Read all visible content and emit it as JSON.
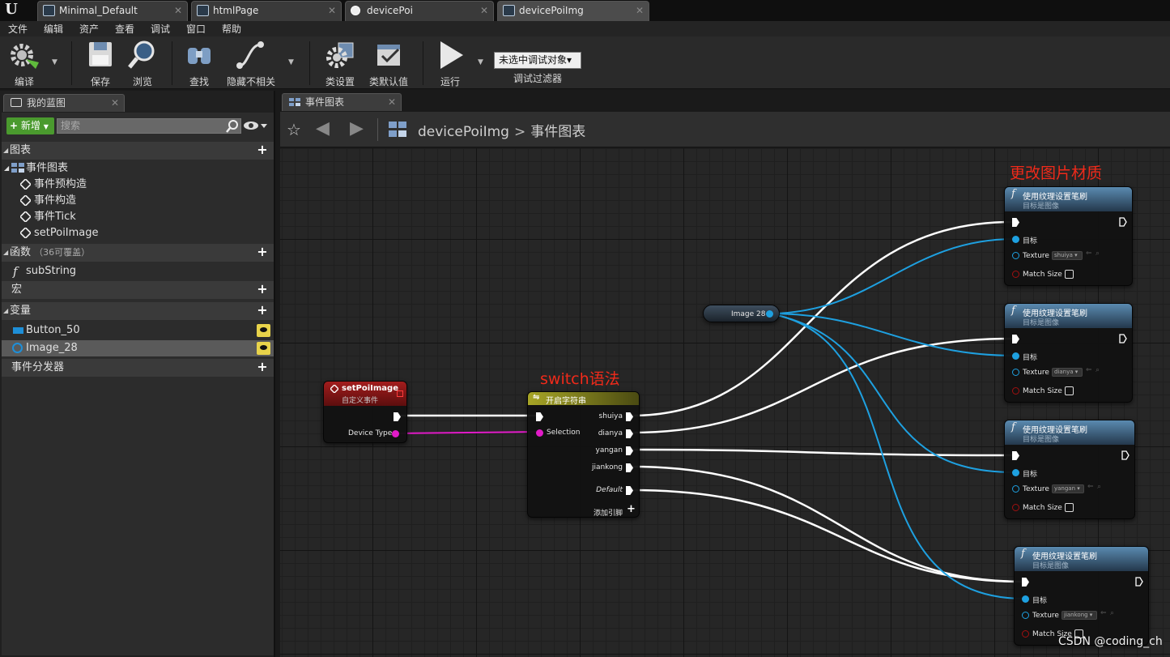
{
  "tabs": [
    {
      "label": "Minimal_Default"
    },
    {
      "label": "htmlPage"
    },
    {
      "label": "devicePoi"
    },
    {
      "label": "devicePoiImg"
    }
  ],
  "menu": [
    "文件",
    "编辑",
    "资产",
    "查看",
    "调试",
    "窗口",
    "帮助"
  ],
  "toolbar": {
    "compile": "编译",
    "save": "保存",
    "browse": "浏览",
    "find": "查找",
    "hide_unrelated": "隐藏不相关",
    "class_settings": "类设置",
    "class_defaults": "类默认值",
    "run": "运行",
    "debug_select": "未选中调试对象▾",
    "debug_filter": "调试过滤器"
  },
  "left_panel": {
    "tab": "我的蓝图",
    "add_new": "新增",
    "search_placeholder": "搜索",
    "sections": {
      "graphs": "图表",
      "event_graph": "事件图表",
      "events": [
        "事件预构造",
        "事件构造",
        "事件Tick",
        "setPoiImage"
      ],
      "functions": "函数",
      "functions_sub": "（36可覆盖）",
      "function_items": [
        "subString"
      ],
      "macros": "宏",
      "variables": "变量",
      "variable_items": [
        "Button_50",
        "Image_28"
      ],
      "dispatchers": "事件分发器"
    }
  },
  "graph": {
    "tab": "事件图表",
    "breadcrumb_root": "devicePoiImg",
    "breadcrumb_sep": ">",
    "breadcrumb_leaf": "事件图表",
    "annotations": {
      "switch": "switch语法",
      "change_material": "更改图片材质"
    },
    "event_node": {
      "title": "setPoiImage",
      "sub": "自定义事件",
      "pin": "Device Type"
    },
    "switch_node": {
      "title": "开启字符串",
      "input": "Selection",
      "outputs": [
        "shuiya",
        "dianya",
        "yangan",
        "jiankong"
      ],
      "default": "Default",
      "add_pin": "添加引脚"
    },
    "image_var": "Image 28",
    "brush_nodes": [
      {
        "title": "使用纹理设置笔刷",
        "sub": "目标是图像",
        "target": "目标",
        "texture_label": "Texture",
        "texture": "shuiya",
        "match_size": "Match Size"
      },
      {
        "title": "使用纹理设置笔刷",
        "sub": "目标是图像",
        "target": "目标",
        "texture_label": "Texture",
        "texture": "dianya",
        "match_size": "Match Size"
      },
      {
        "title": "使用纹理设置笔刷",
        "sub": "目标是图像",
        "target": "目标",
        "texture_label": "Texture",
        "texture": "yangan",
        "match_size": "Match Size"
      },
      {
        "title": "使用纹理设置笔刷",
        "sub": "目标是图像",
        "target": "目标",
        "texture_label": "Texture",
        "texture": "jiankong",
        "match_size": "Match Size"
      }
    ]
  },
  "colors": {
    "exec_wire": "#ffffff",
    "object_wire": "#1ea0e0",
    "string_wire": "#e21bc8",
    "event_header": "#8a1313",
    "switch_header": "#8a8a1a",
    "function_header": "#3d6a8c",
    "annotation": "#f02a1a"
  },
  "watermark": "CSDN @coding_ch"
}
